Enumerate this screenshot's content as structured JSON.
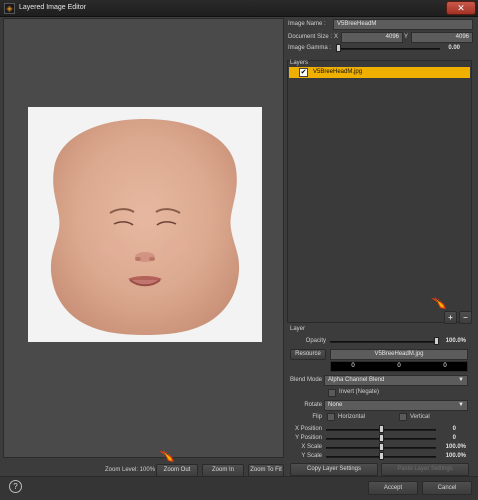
{
  "window": {
    "title": "Layered Image Editor",
    "close_label": "✕",
    "app_icon_glyph": "◈"
  },
  "image": {
    "name_label": "Image Name :",
    "name_value": "V5BreeHeadM",
    "doc_size_label": "Document Size :",
    "x_label": "X",
    "x_value": "4096",
    "y_label": "Y",
    "y_value": "4096",
    "gamma_label": "Image Gamma :",
    "gamma_value": "0.00",
    "gamma_level": 0.02
  },
  "layers": {
    "header": "Layers",
    "items": [
      {
        "name": "V5BreeHeadM.jpg",
        "checked": true,
        "selected": true
      }
    ],
    "add_label": "+",
    "remove_label": "–"
  },
  "layer": {
    "section_label": "Layer",
    "opacity_label": "Opacity",
    "opacity_value": "100.0%",
    "opacity_level": 1.0,
    "resource_label": "Resource",
    "resource_value": "V5BreeHeadM.jpg",
    "color_values": [
      "0",
      "0",
      "0"
    ],
    "blend_mode_label": "Blend Mode",
    "blend_mode_value": "Alpha Channel Blend",
    "invert_label": "Invert (Negate)",
    "rotate_label": "Rotate",
    "rotate_value": "None",
    "flip_label": "Flip",
    "horizontal_label": "Horizontal",
    "vertical_label": "Vertical",
    "x_position_label": "X Position",
    "x_position_value": "0",
    "x_position_level": 0.5,
    "y_position_label": "Y Position",
    "y_position_value": "0",
    "y_position_level": 0.5,
    "x_scale_label": "X Scale",
    "x_scale_value": "100.0%",
    "x_scale_level": 0.5,
    "y_scale_label": "Y Scale",
    "y_scale_value": "100.0%",
    "y_scale_level": 0.5,
    "copy_settings_label": "Copy Layer Settings",
    "paste_settings_label": "Paste Layer Settings"
  },
  "zoom": {
    "level_label": "Zoom Level: 100%",
    "zoom_out_label": "Zoom Out",
    "zoom_in_label": "Zoom In",
    "zoom_fit_label": "Zoom To Fit"
  },
  "footer": {
    "help_label": "?",
    "accept_label": "Accept",
    "cancel_label": "Cancel"
  },
  "colors": {
    "selection": "#f0b000",
    "annotation_arrow": "#e03a10",
    "annotation_arrow_light": "#f7b500"
  }
}
